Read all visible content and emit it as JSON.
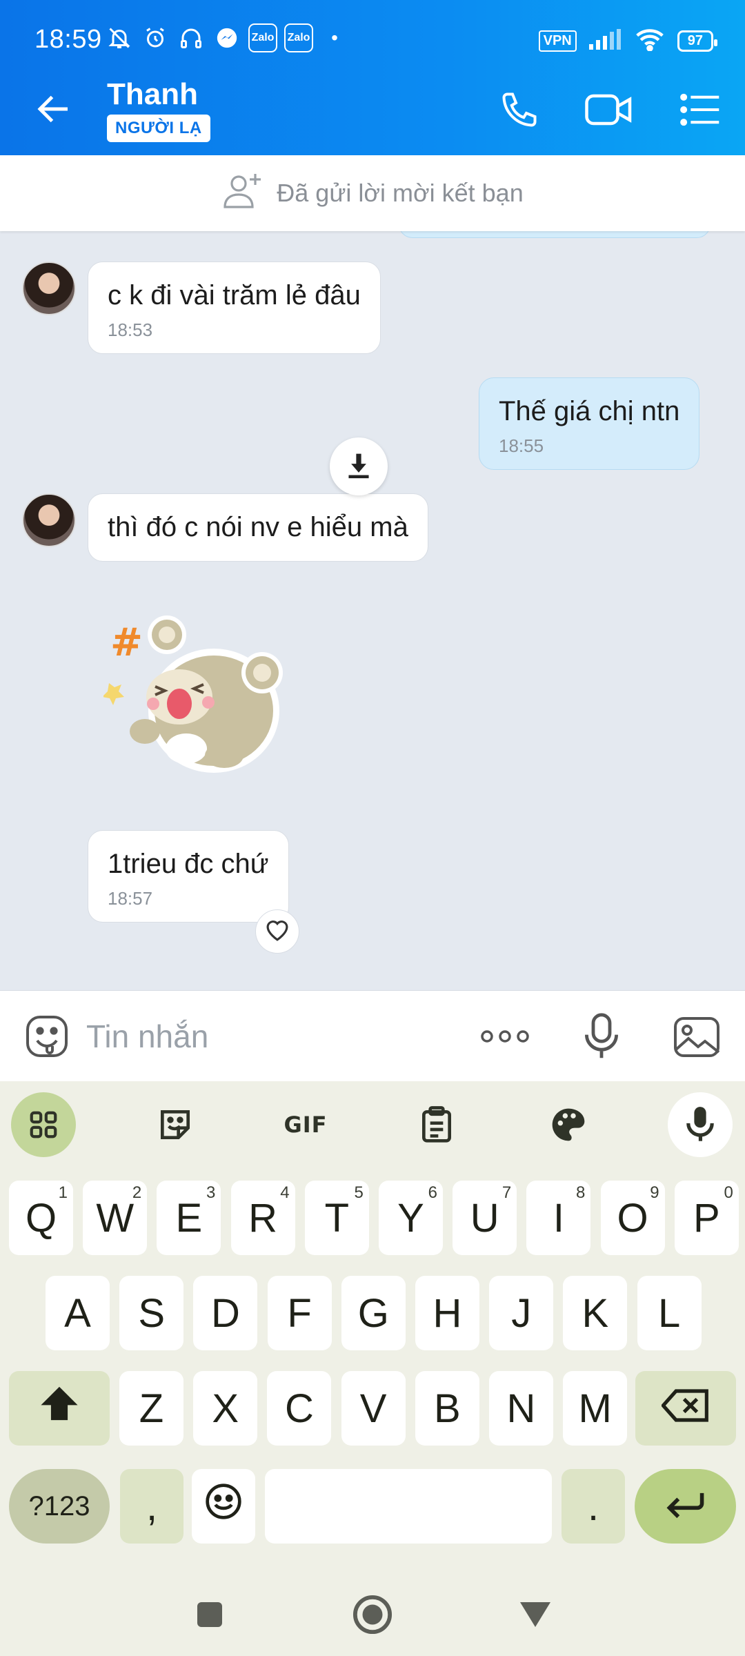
{
  "status_bar": {
    "time": "18:59",
    "zalo_badge_1": "Zalo",
    "zalo_badge_2": "Zalo",
    "dot": "•",
    "vpn": "VPN",
    "battery": "97"
  },
  "header": {
    "contact_name": "Thanh",
    "badge": "NGƯỜI LẠ"
  },
  "friend_banner": {
    "text": "Đã gửi lời mời kết bạn"
  },
  "messages": [
    {
      "side": "them",
      "text": "c k đi vài trăm lẻ đâu",
      "time": "18:53"
    },
    {
      "side": "me",
      "text": "Thế giá chị ntn",
      "time": "18:55"
    },
    {
      "side": "them",
      "text": "thì đó c nói nv e hiểu mà",
      "time": ""
    },
    {
      "side": "them",
      "text": "1trieu đc chứ",
      "time": "18:57"
    }
  ],
  "composer": {
    "placeholder": "Tin nhắn"
  },
  "keyboard": {
    "toolbar": {
      "gif": "GIF"
    },
    "row1": [
      {
        "k": "Q",
        "h": "1"
      },
      {
        "k": "W",
        "h": "2"
      },
      {
        "k": "E",
        "h": "3"
      },
      {
        "k": "R",
        "h": "4"
      },
      {
        "k": "T",
        "h": "5"
      },
      {
        "k": "Y",
        "h": "6"
      },
      {
        "k": "U",
        "h": "7"
      },
      {
        "k": "I",
        "h": "8"
      },
      {
        "k": "O",
        "h": "9"
      },
      {
        "k": "P",
        "h": "0"
      }
    ],
    "row2": [
      "A",
      "S",
      "D",
      "F",
      "G",
      "H",
      "J",
      "K",
      "L"
    ],
    "row3": [
      "Z",
      "X",
      "C",
      "V",
      "B",
      "N",
      "M"
    ],
    "row4": {
      "symbols": "?123",
      "comma": ",",
      "period": "."
    }
  },
  "colors": {
    "header_blue": "#0a74e8",
    "my_bubble": "#d4ecfb",
    "chat_bg": "#e4e9f0",
    "keyboard_accent": "#c3d69a"
  }
}
